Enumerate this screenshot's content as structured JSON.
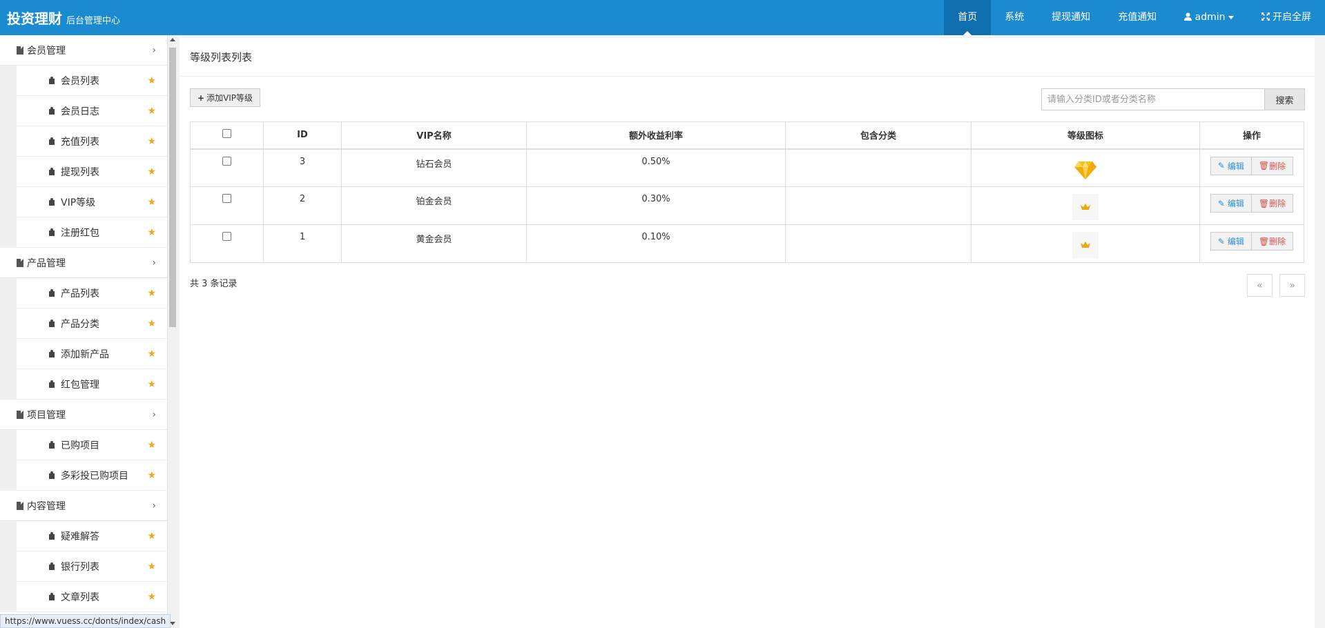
{
  "brand": {
    "title": "投资理财",
    "subtitle": "后台管理中心"
  },
  "topnav": [
    {
      "label": "首页",
      "active": true
    },
    {
      "label": "系统"
    },
    {
      "label": "提现通知"
    },
    {
      "label": "充值通知"
    },
    {
      "label": "admin",
      "icon": "user-icon",
      "dropdown": true
    },
    {
      "label": "开启全屏",
      "icon": "fullscreen-icon"
    }
  ],
  "sidebar": {
    "groups": [
      {
        "label": "会员管理",
        "items": [
          "会员列表",
          "会员日志",
          "充值列表",
          "提现列表",
          "VIP等级",
          "注册红包"
        ]
      },
      {
        "label": "产品管理",
        "items": [
          "产品列表",
          "产品分类",
          "添加新产品",
          "红包管理"
        ]
      },
      {
        "label": "项目管理",
        "items": [
          "已购项目",
          "多彩投已购项目"
        ]
      },
      {
        "label": "内容管理",
        "items": [
          "疑难解答",
          "银行列表",
          "文章列表"
        ]
      }
    ]
  },
  "page": {
    "title": "等级列表列表",
    "add_button": "添加VIP等级",
    "search_placeholder": "请输入分类ID或者分类名称",
    "search_button": "搜索"
  },
  "table": {
    "headers": [
      "",
      "ID",
      "VIP名称",
      "额外收益利率",
      "包含分类",
      "等级图标",
      "操作"
    ],
    "rows": [
      {
        "id": "3",
        "name": "钻石会员",
        "rate": "0.50%",
        "category": "",
        "icon": "diamond-icon"
      },
      {
        "id": "2",
        "name": "铂金会员",
        "rate": "0.30%",
        "category": "",
        "icon": "crown-icon"
      },
      {
        "id": "1",
        "name": "黄金会员",
        "rate": "0.10%",
        "category": "",
        "icon": "crown-icon"
      }
    ],
    "edit_label": "编辑",
    "delete_label": "删除"
  },
  "footer": {
    "count_text": "共 3 条记录",
    "prev": "«",
    "next": "»"
  },
  "statusbar": {
    "url": "https://www.vuess.cc/donts/index/cash"
  },
  "colors": {
    "topbar": "#1a8ad1",
    "topbar_active": "#0f6fae",
    "star": "#f0a71e",
    "edit": "#2b8fd6",
    "delete": "#d9534f"
  }
}
